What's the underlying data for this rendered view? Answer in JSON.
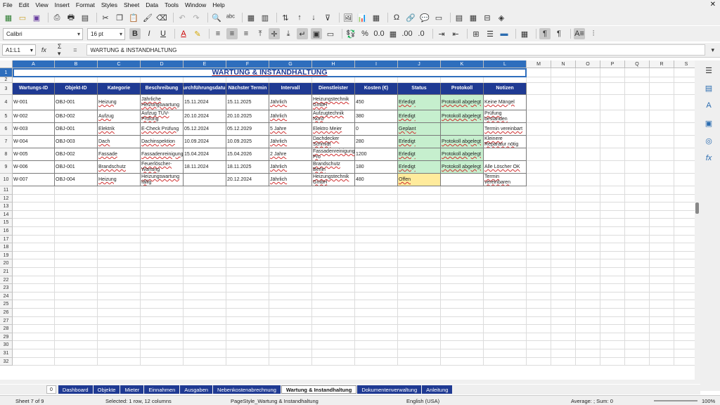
{
  "menu": [
    "File",
    "Edit",
    "View",
    "Insert",
    "Format",
    "Styles",
    "Sheet",
    "Data",
    "Tools",
    "Window",
    "Help"
  ],
  "toolbar": {
    "font_name": "Calibri",
    "font_size": "16 pt"
  },
  "formula_bar": {
    "cell_ref": "A1:L1",
    "content": "WARTUNG & INSTANDHALTUNG"
  },
  "columns": [
    "A",
    "B",
    "C",
    "D",
    "E",
    "F",
    "G",
    "H",
    "I",
    "J",
    "K",
    "L",
    "M",
    "N",
    "O",
    "P",
    "Q",
    "R",
    "S"
  ],
  "rows": [
    "1",
    "2",
    "3",
    "4",
    "5",
    "6",
    "7",
    "8",
    "9",
    "10",
    "11",
    "12",
    "13",
    "14",
    "15",
    "16",
    "17",
    "18",
    "19",
    "20",
    "21",
    "22",
    "23",
    "24",
    "25",
    "26",
    "27",
    "28",
    "29",
    "30",
    "31",
    "32"
  ],
  "sheet_title": "WARTUNG & INSTANDHALTUNG",
  "table_headers": [
    "Wartungs-ID",
    "Objekt-ID",
    "Kategorie",
    "Beschreibung",
    "Durchführungsdatum",
    "Nächster Termin",
    "Intervall",
    "Dienstleister",
    "Kosten (€)",
    "Status",
    "Protokoll",
    "Notizen"
  ],
  "table_rows": [
    [
      "W-001",
      "OBJ-001",
      "Heizung",
      "Jährliche Heizungswartung",
      "15.11.2024",
      "15.11.2025",
      "Jährlich",
      "Heizungstechnik GmbH",
      "450",
      "Erledigt",
      "Protokoll abgelegt",
      "Keine Mängel"
    ],
    [
      "W-002",
      "OBJ-002",
      "Aufzug",
      "Aufzug TÜV-Prüfung",
      "20.10.2024",
      "20.10.2025",
      "Jährlich",
      "Aufzugtechnik Nord",
      "380",
      "Erledigt",
      "Protokoll abgelegt",
      "Prüfung bestanden"
    ],
    [
      "W-003",
      "OBJ-001",
      "Elektrik",
      "E-Check Prüfung",
      "05.12.2024",
      "05.12.2029",
      "5 Jahre",
      "Elektro Meier",
      "0",
      "Geplant",
      "",
      "Termin vereinbart"
    ],
    [
      "W-004",
      "OBJ-003",
      "Dach",
      "Dachinspektion",
      "10.09.2024",
      "10.09.2025",
      "Jährlich",
      "Dachdecker Schmidt",
      "280",
      "Erledigt",
      "Protokoll abgelegt",
      "Kleinere Reparatur nötig"
    ],
    [
      "W-005",
      "OBJ-002",
      "Fassade",
      "Fassadenreinigung",
      "15.04.2024",
      "15.04.2026",
      "2 Jahre",
      "Fassadenreinigung Pro",
      "1200",
      "Erledigt",
      "Protokoll abgelegt",
      ""
    ],
    [
      "W-006",
      "OBJ-001",
      "Brandschutz",
      "Feuerlöscher-Wartung",
      "18.11.2024",
      "18.11.2025",
      "Jährlich",
      "Brandschutz Berlin",
      "180",
      "Erledigt",
      "Protokoll abgelegt",
      "Alle Löscher OK"
    ],
    [
      "W-007",
      "OBJ-004",
      "Heizung",
      "Heizungswartung fällig",
      "",
      "20.12.2024",
      "Jährlich",
      "Heizungstechnik GmbH",
      "480",
      "Offen",
      "",
      "Termin vereinbaren"
    ]
  ],
  "tabs": {
    "num": "0",
    "items": [
      "Dashboard",
      "Objekte",
      "Mieter",
      "Einnahmen",
      "Ausgaben",
      "Nebenkostenabrechnung",
      "Wartung & Instandhaltung",
      "Dokumentenverwaltung",
      "Anleitung"
    ],
    "active": "Wartung & Instandhaltung"
  },
  "status": {
    "sheet": "Sheet 7 of 9",
    "selection": "Selected: 1 row, 12 columns",
    "page_style": "PageStyle_Wartung & Instandhaltung",
    "language": "English (USA)",
    "sum": "Average: ; Sum: 0",
    "zoom": "100%"
  },
  "colors": {
    "header_bg": "#1f3a93",
    "status_green": "#c6efce",
    "status_yellow": "#ffeb9c",
    "selection": "#2e6ebd"
  }
}
